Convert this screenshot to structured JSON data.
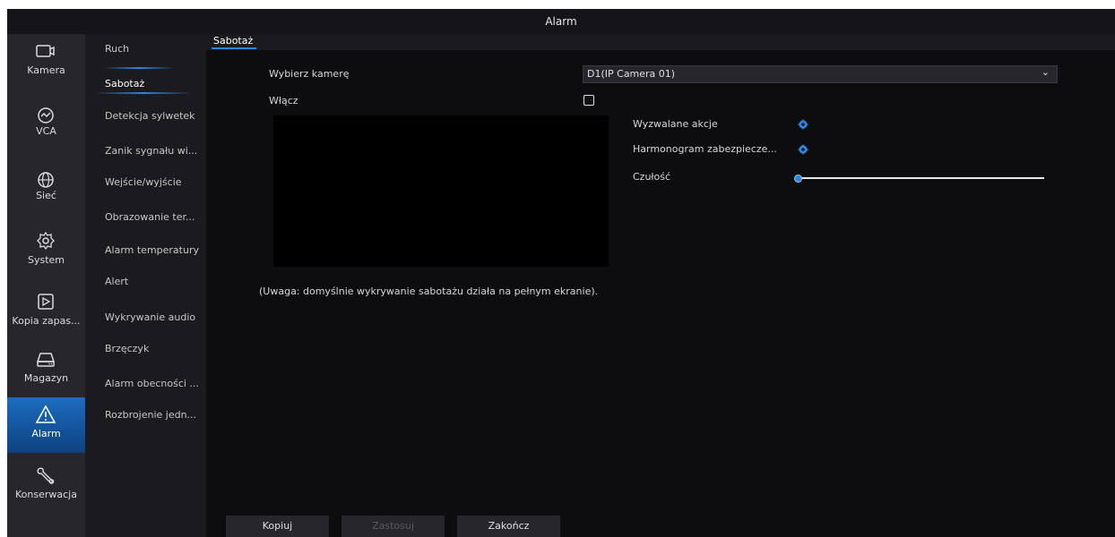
{
  "window": {
    "title": "Alarm"
  },
  "nav": {
    "items": [
      {
        "label": "Kamera",
        "icon": "camera-icon"
      },
      {
        "label": "VCA",
        "icon": "vca-icon"
      },
      {
        "label": "Sieć",
        "icon": "network-globe-icon"
      },
      {
        "label": "System",
        "icon": "system-gear-icon"
      },
      {
        "label": "Kopia zapas...",
        "icon": "backup-icon"
      },
      {
        "label": "Magazyn",
        "icon": "storage-hdd-icon"
      },
      {
        "label": "Alarm",
        "icon": "alarm-warning-icon",
        "active": true
      },
      {
        "label": "Konserwacja",
        "icon": "maintenance-wrench-icon"
      }
    ]
  },
  "submenu": {
    "items": [
      {
        "label": "Ruch"
      },
      {
        "label": "Sabotaż",
        "active": true
      },
      {
        "label": "Detekcja sylwetek"
      },
      {
        "label": "Zanik sygnału wi..."
      },
      {
        "label": "Wejście/wyjście"
      },
      {
        "label": "Obrazowanie ter..."
      },
      {
        "label": "Alarm temperatury"
      },
      {
        "label": "Alert"
      },
      {
        "label": "Wykrywanie audio"
      },
      {
        "label": "Brzęczyk"
      },
      {
        "label": "Alarm obecności ..."
      },
      {
        "label": "Rozbrojenie jedn..."
      }
    ]
  },
  "tabs": [
    {
      "label": "Sabotaż",
      "active": true
    }
  ],
  "form": {
    "camera_label": "Wybierz kamerę",
    "camera_value": "D1(IP Camera 01)",
    "enable_label": "Włącz",
    "enable_checked": false,
    "triggered_actions_label": "Wyzwalane akcje",
    "schedule_label": "Harmonogram zabezpiecze...",
    "sensitivity_label": "Czułość",
    "sensitivity_level": 0.0
  },
  "note": "(Uwaga: domyślnie wykrywanie sabotażu działa na pełnym ekranie).",
  "buttons": {
    "copy": "Kopiuj",
    "apply": "Zastosuj",
    "exit": "Zakończ"
  },
  "colors": {
    "accent": "#2a86e0",
    "background": "#0d0d10",
    "nav_bg": "#26262c",
    "active_nav": "#1d6cc0"
  }
}
